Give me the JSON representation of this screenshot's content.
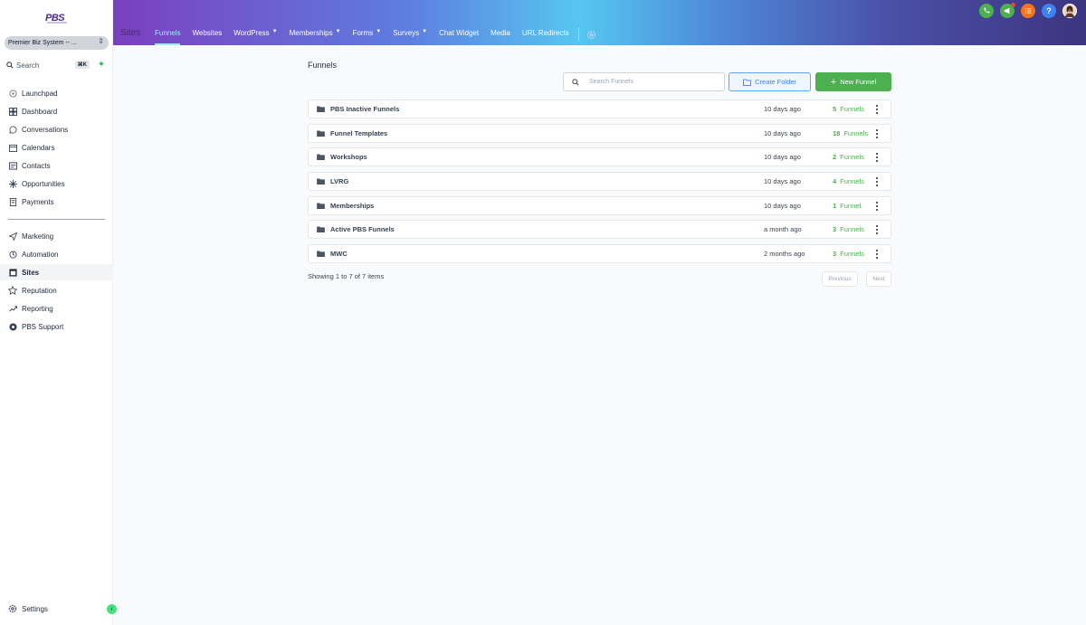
{
  "sidebar": {
    "logo": "PBS",
    "account": "Premier Biz System -- ...",
    "search_label": "Search",
    "search_shortcut": "⌘K",
    "nav_primary": [
      {
        "label": "Launchpad",
        "icon": "rocket-icon"
      },
      {
        "label": "Dashboard",
        "icon": "dashboard-icon"
      },
      {
        "label": "Conversations",
        "icon": "chat-icon"
      },
      {
        "label": "Calendars",
        "icon": "calendar-icon"
      },
      {
        "label": "Contacts",
        "icon": "contacts-icon"
      },
      {
        "label": "Opportunities",
        "icon": "opportunities-icon"
      },
      {
        "label": "Payments",
        "icon": "payments-icon"
      }
    ],
    "nav_secondary": [
      {
        "label": "Marketing",
        "icon": "send-icon"
      },
      {
        "label": "Automation",
        "icon": "automation-icon"
      },
      {
        "label": "Sites",
        "icon": "sites-icon",
        "active": true
      },
      {
        "label": "Reputation",
        "icon": "star-icon"
      },
      {
        "label": "Reporting",
        "icon": "trend-icon"
      },
      {
        "label": "PBS Support",
        "icon": "support-icon"
      }
    ],
    "settings_label": "Settings"
  },
  "header": {
    "title": "Sites",
    "tabs": [
      {
        "label": "Funnels",
        "active": true,
        "dropdown": false
      },
      {
        "label": "Websites",
        "dropdown": false
      },
      {
        "label": "WordPress",
        "dropdown": true
      },
      {
        "label": "Memberships",
        "dropdown": true
      },
      {
        "label": "Forms",
        "dropdown": true
      },
      {
        "label": "Surveys",
        "dropdown": true
      },
      {
        "label": "Chat Widget",
        "dropdown": false
      },
      {
        "label": "Media",
        "dropdown": false
      },
      {
        "label": "URL Redirects",
        "dropdown": false
      }
    ],
    "icons": [
      {
        "name": "phone-icon",
        "color": "#4caf50"
      },
      {
        "name": "megaphone-icon",
        "color": "#4caf50"
      },
      {
        "name": "list-icon",
        "color": "#f97316"
      },
      {
        "name": "help-icon",
        "color": "#3b82f6"
      },
      {
        "name": "avatar",
        "color": "#e8d5c4"
      }
    ]
  },
  "main": {
    "title": "Funnels",
    "search_placeholder": "Search Funnels",
    "create_folder_label": "Create Folder",
    "new_funnel_label": "New Funnel",
    "rows": [
      {
        "name": "PBS Inactive Funnels",
        "updated": "10 days ago",
        "count": "5",
        "unit": "Funnels"
      },
      {
        "name": "Funnel Templates",
        "updated": "10 days ago",
        "count": "18",
        "unit": "Funnels"
      },
      {
        "name": "Workshops",
        "updated": "10 days ago",
        "count": "2",
        "unit": "Funnels"
      },
      {
        "name": "LVRG",
        "updated": "10 days ago",
        "count": "4",
        "unit": "Funnels"
      },
      {
        "name": "Memberships",
        "updated": "10 days ago",
        "count": "1",
        "unit": "Funnel"
      },
      {
        "name": "Active PBS Funnels",
        "updated": "a month ago",
        "count": "3",
        "unit": "Funnels"
      },
      {
        "name": "MWC",
        "updated": "2 months ago",
        "count": "3",
        "unit": "Funnels"
      }
    ],
    "showing": "Showing 1 to 7 of 7 items",
    "prev_label": "Previous",
    "next_label": "Next"
  },
  "colors": {
    "accent_green": "#4caf50",
    "accent_blue": "#3b82f6"
  }
}
